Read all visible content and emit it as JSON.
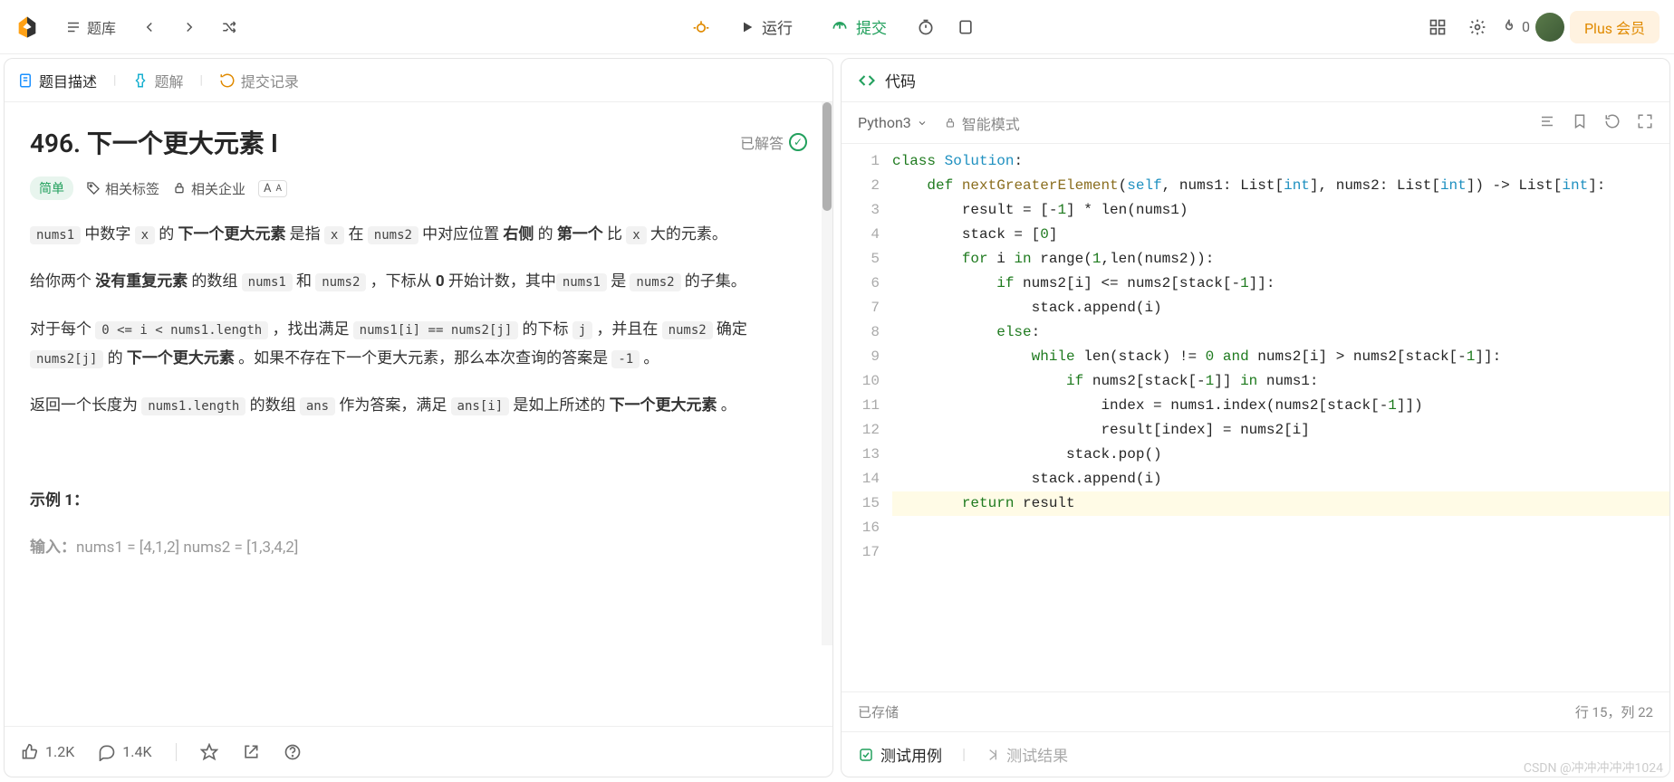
{
  "topbar": {
    "problemset": "题库",
    "run": "运行",
    "submit": "提交",
    "fire_count": "0",
    "plus": "Plus 会员"
  },
  "left": {
    "tabs": {
      "description": "题目描述",
      "solution": "题解",
      "submissions": "提交记录"
    },
    "title": "496. 下一个更大元素 I",
    "solved": "已解答",
    "difficulty": "简单",
    "tags": {
      "related_tags": "相关标签",
      "companies": "相关企业"
    },
    "example_heading": "示例 1：",
    "footer": {
      "likes": "1.2K",
      "comments": "1.4K"
    }
  },
  "right": {
    "code_label": "代码",
    "language": "Python3",
    "smart_mode": "智能模式",
    "saved": "已存储",
    "cursor": "行 15，列 22",
    "test_cases": "测试用例",
    "test_results": "测试结果",
    "code_lines": 17
  },
  "watermark": "CSDN @冲冲冲冲冲1024"
}
